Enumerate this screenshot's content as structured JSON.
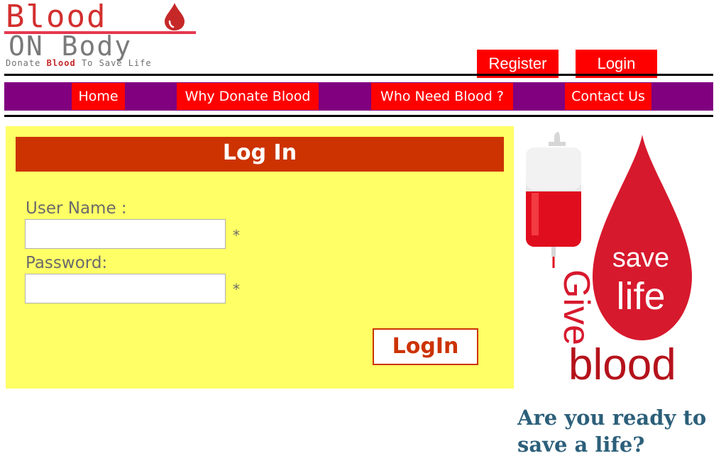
{
  "logo": {
    "word1": "Blood",
    "word2": "ON Body",
    "tagline_pre": "Donate",
    "tagline_highlight": "Blood",
    "tagline_post": "To Save Life"
  },
  "header": {
    "register_label": "Register",
    "login_label": "Login"
  },
  "nav": {
    "items": [
      {
        "label": "Home"
      },
      {
        "label": "Why Donate Blood"
      },
      {
        "label": "Who Need Blood ?"
      },
      {
        "label": "Contact Us"
      }
    ]
  },
  "login_form": {
    "title": "Log In",
    "username_label": "User Name :",
    "username_value": "",
    "password_label": "Password:",
    "password_value": "",
    "required_mark": "*",
    "submit_label": "LogIn"
  },
  "illustration": {
    "drop_text_1": "save",
    "drop_text_2": "life",
    "give_text": "Give",
    "blood_text": "blood"
  },
  "promo": {
    "tagline": "Are you ready to save a life?"
  },
  "colors": {
    "nav_bg": "#800080",
    "button_red": "#ff0000",
    "panel_yellow": "#ffff66",
    "header_rust": "#cc3300",
    "tagline_blue": "#2c5f7a",
    "blood_red": "#c8102e"
  }
}
